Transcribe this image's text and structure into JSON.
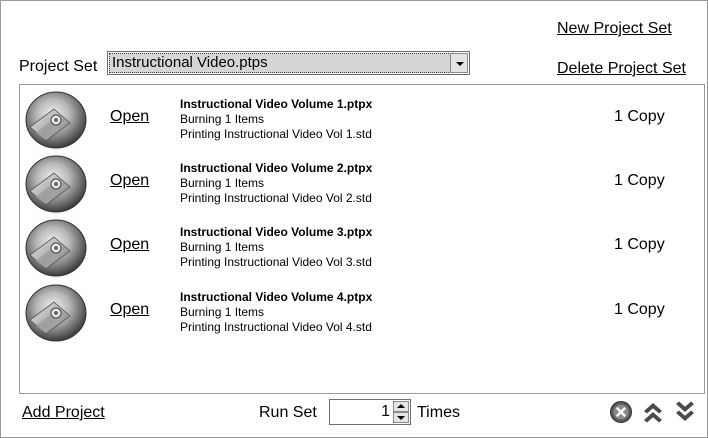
{
  "header": {
    "new_project_set": "New Project Set",
    "delete_project_set": "Delete Project Set",
    "project_set_label": "Project Set",
    "project_set_value": "Instructional Video.ptps"
  },
  "projects": [
    {
      "open_label": "Open",
      "title": "Instructional Video Volume 1.ptpx",
      "burning": "Burning 1 Items",
      "printing": "Printing Instructional Video Vol 1.std",
      "copies": "1 Copy"
    },
    {
      "open_label": "Open",
      "title": "Instructional Video Volume 2.ptpx",
      "burning": "Burning 1 Items",
      "printing": "Printing Instructional Video Vol 2.std",
      "copies": "1 Copy"
    },
    {
      "open_label": "Open",
      "title": "Instructional Video Volume 3.ptpx",
      "burning": "Burning 1 Items",
      "printing": "Printing Instructional Video Vol 3.std",
      "copies": "1 Copy"
    },
    {
      "open_label": "Open",
      "title": "Instructional Video Volume 4.ptpx",
      "burning": "Burning 1 Items",
      "printing": "Printing Instructional Video Vol 4.std",
      "copies": "1 Copy"
    }
  ],
  "footer": {
    "add_project": "Add Project",
    "run_set_label": "Run Set",
    "run_set_value": "1",
    "times_label": "Times"
  },
  "icons": {
    "project": "disc-icon",
    "close": "close-circle-icon",
    "move_up": "double-chevron-up-icon",
    "move_down": "double-chevron-down-icon"
  },
  "colors": {
    "disc_dark": "#5a5a5a",
    "disc_light": "#d8d8d8",
    "selection": "#d6d6d6"
  }
}
